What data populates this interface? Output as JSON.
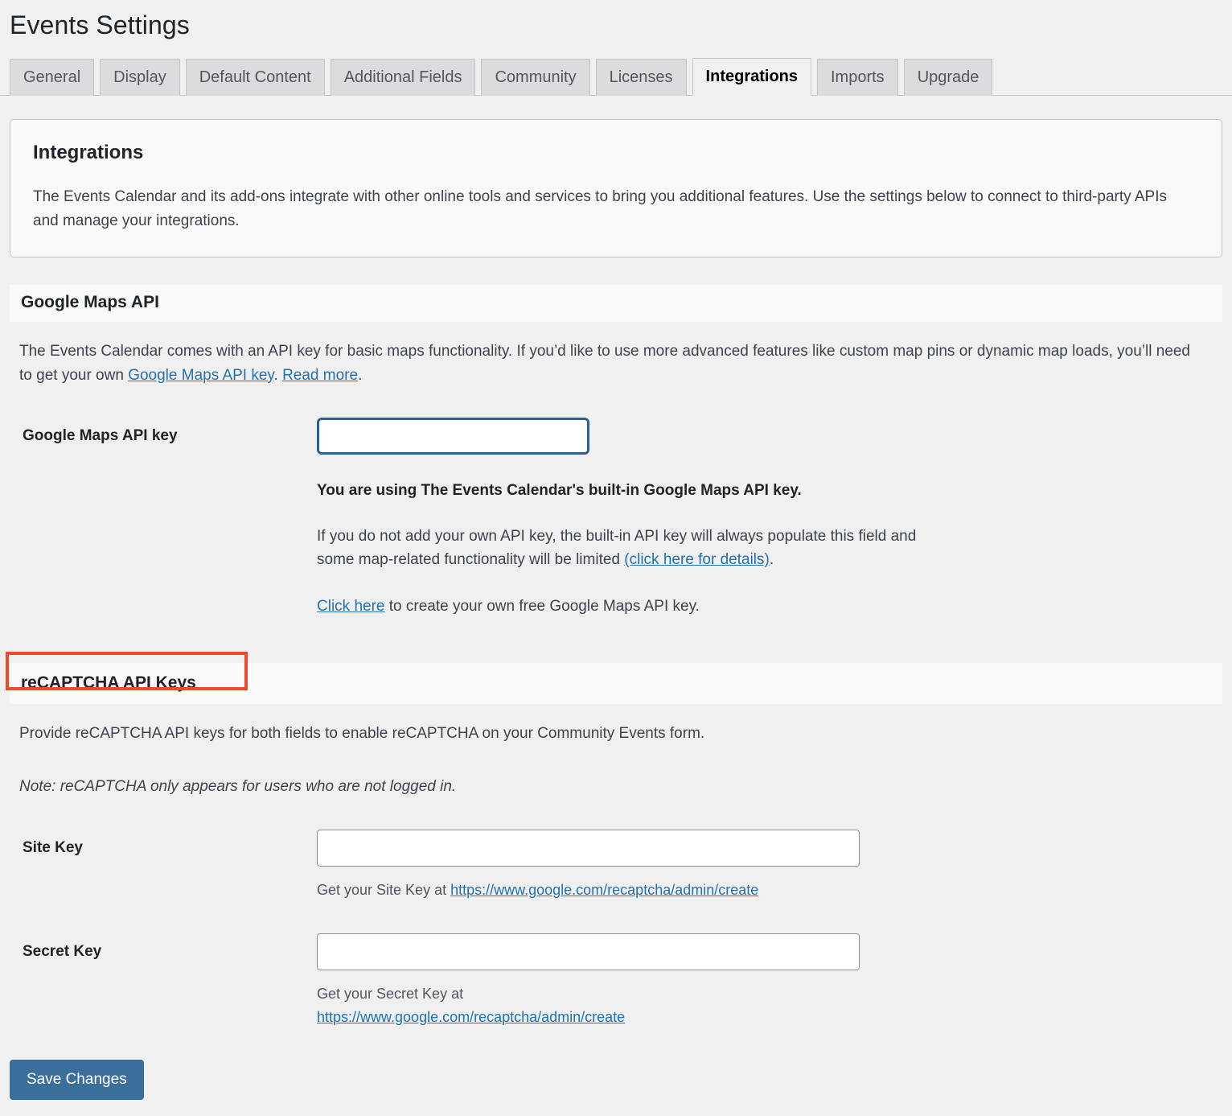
{
  "page": {
    "title": "Events Settings"
  },
  "tabs": [
    {
      "label": "General",
      "active": false
    },
    {
      "label": "Display",
      "active": false
    },
    {
      "label": "Default Content",
      "active": false
    },
    {
      "label": "Additional Fields",
      "active": false
    },
    {
      "label": "Community",
      "active": false
    },
    {
      "label": "Licenses",
      "active": false
    },
    {
      "label": "Integrations",
      "active": true
    },
    {
      "label": "Imports",
      "active": false
    },
    {
      "label": "Upgrade",
      "active": false
    }
  ],
  "intro": {
    "heading": "Integrations",
    "body": "The Events Calendar and its add-ons integrate with other online tools and services to bring you additional features. Use the settings below to connect to third-party APIs and manage your integrations."
  },
  "google_maps": {
    "section_title": "Google Maps API",
    "desc_part1": "The Events Calendar comes with an API key for basic maps functionality. If you’d like to use more advanced features like custom map pins or dynamic map loads, you’ll need to get your own ",
    "desc_link1": "Google Maps API key",
    "desc_part2": ". ",
    "desc_link2": "Read more",
    "desc_part3": ".",
    "field_label": "Google Maps API key",
    "field_value": "",
    "field_placeholder": "",
    "help_strong": "You are using The Events Calendar's built-in Google Maps API key.",
    "help_p2_part1": "If you do not add your own API key, the built-in API key will always populate this field and some map-related functionality will be limited ",
    "help_p2_link": "(click here for details)",
    "help_p2_part2": ".",
    "help_p3_link": "Click here",
    "help_p3_text": " to create your own free Google Maps API key."
  },
  "recaptcha": {
    "section_title": "reCAPTCHA API Keys",
    "desc": "Provide reCAPTCHA API keys for both fields to enable reCAPTCHA on your Community Events form.",
    "note": "Note: reCAPTCHA only appears for users who are not logged in.",
    "site_key": {
      "label": "Site Key",
      "value": "",
      "placeholder": "",
      "help_prefix": "Get your Site Key at ",
      "help_link": "https://www.google.com/recaptcha/admin/create"
    },
    "secret_key": {
      "label": "Secret Key",
      "value": "",
      "placeholder": "",
      "help_prefix": "Get your Secret Key at",
      "help_link": "https://www.google.com/recaptcha/admin/create"
    }
  },
  "footer": {
    "save_label": "Save Changes"
  },
  "annotation": {
    "highlight_color": "#ec4a29",
    "target": "reCAPTCHA API Keys"
  },
  "colors": {
    "page_bg": "#f0f0f1",
    "panel_bg": "#f9f9f9",
    "link": "#2271b1",
    "focus_border": "#2c5f94",
    "button_bg": "#3a6f9b"
  }
}
